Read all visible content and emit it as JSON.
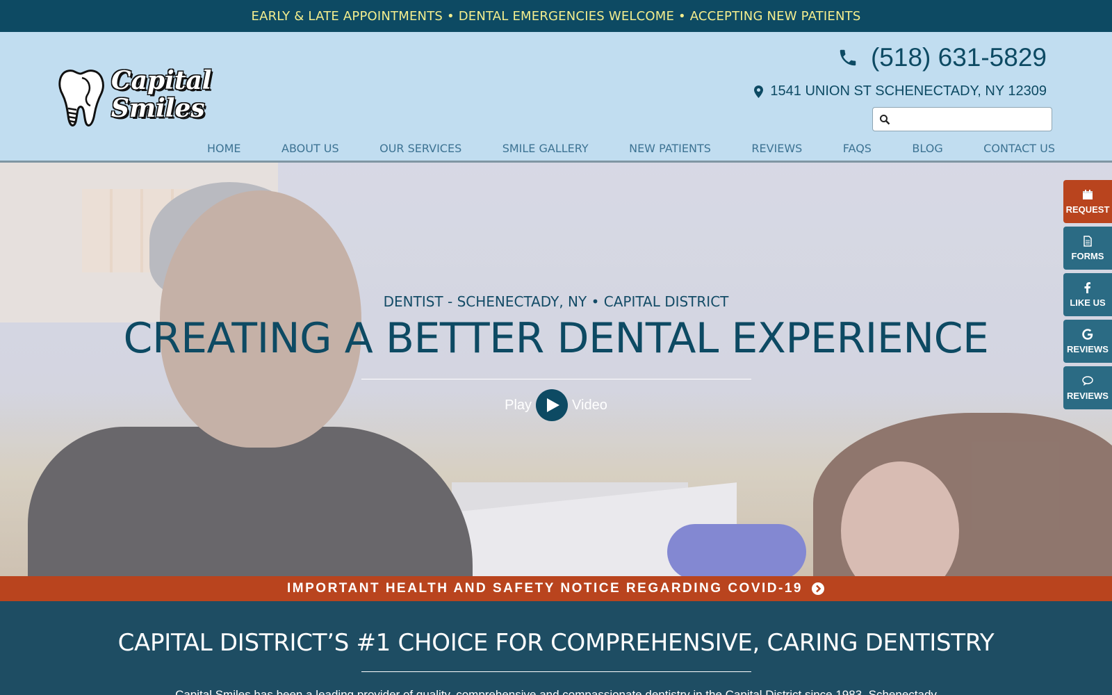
{
  "topbar": {
    "text": "EARLY & LATE APPOINTMENTS • DENTAL EMERGENCIES WELCOME • ACCEPTING NEW PATIENTS"
  },
  "header": {
    "logo": {
      "line1": "Capital",
      "line2": "Smiles"
    },
    "phone": "(518) 631-5829",
    "address": "1541 UNION ST SCHENECTADY, NY 12309",
    "search": {
      "value": "",
      "placeholder": ""
    },
    "nav": [
      "HOME",
      "ABOUT US",
      "OUR SERVICES",
      "SMILE GALLERY",
      "NEW PATIENTS",
      "REVIEWS",
      "FAQS",
      "BLOG",
      "CONTACT US"
    ]
  },
  "hero": {
    "subtitle": "DENTIST - SCHENECTADY, NY • CAPITAL DISTRICT",
    "title": "CREATING A BETTER DENTAL EXPERIENCE",
    "play_label": "Play",
    "video_label": "Video"
  },
  "side_tabs": [
    {
      "label": "REQUEST",
      "icon": "calendar-icon",
      "color": "#b9441e"
    },
    {
      "label": "FORMS",
      "icon": "document-icon",
      "color": "#2b6b84"
    },
    {
      "label": "LIKE US",
      "icon": "facebook-icon",
      "color": "#2b6b84"
    },
    {
      "label": "REVIEWS",
      "icon": "google-icon",
      "color": "#2b6b84"
    },
    {
      "label": "REVIEWS",
      "icon": "chat-bubble-icon",
      "color": "#2b6b84"
    }
  ],
  "covid_notice": "IMPORTANT HEALTH AND SAFETY NOTICE REGARDING COVID-19",
  "section": {
    "title": "CAPITAL DISTRICT’S #1 CHOICE FOR COMPREHENSIVE, CARING DENTISTRY",
    "text": "Capital Smiles has been a leading provider of quality, comprehensive and compassionate dentistry in the Capital District since 1983. Schenectady"
  },
  "colors": {
    "topbar_bg": "#0d4a63",
    "topbar_text": "#f4ee8e",
    "header_bg": "#c1ddf0",
    "accent_red": "#b9441e",
    "section_bg": "#1e4d63"
  }
}
